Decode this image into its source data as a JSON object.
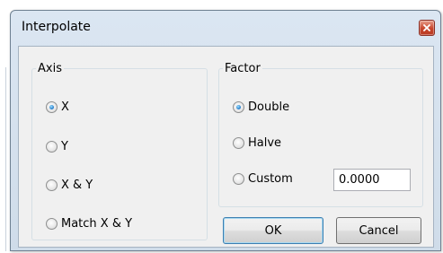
{
  "window": {
    "title": "Interpolate"
  },
  "icons": {
    "close": "close-icon"
  },
  "axis": {
    "legend": "Axis",
    "options": [
      {
        "label": "X",
        "checked": true
      },
      {
        "label": "Y",
        "checked": false
      },
      {
        "label": "X & Y",
        "checked": false
      },
      {
        "label": "Match X & Y",
        "checked": false
      }
    ]
  },
  "factor": {
    "legend": "Factor",
    "options": [
      {
        "label": "Double",
        "checked": true
      },
      {
        "label": "Halve",
        "checked": false
      },
      {
        "label": "Custom",
        "checked": false
      }
    ],
    "custom_value": "0.0000"
  },
  "buttons": {
    "ok": "OK",
    "cancel": "Cancel"
  }
}
